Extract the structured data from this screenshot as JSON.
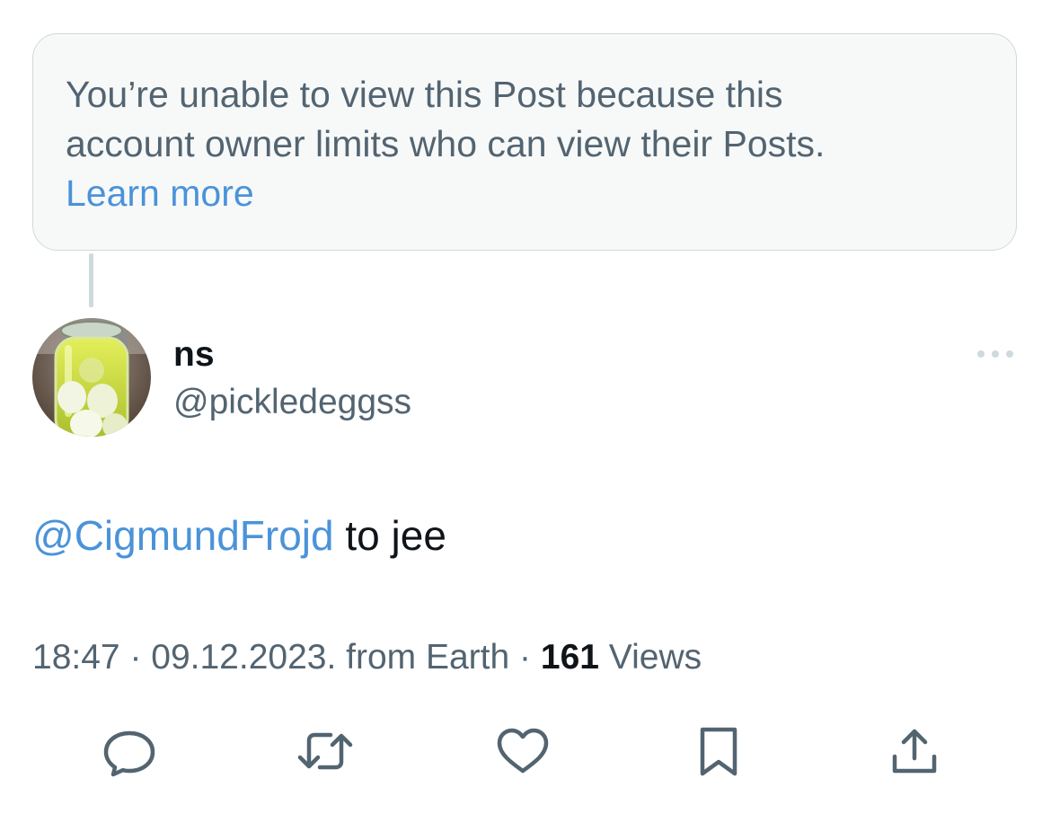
{
  "notice": {
    "line1": "You’re unable to view this Post because this",
    "line2": "account owner limits who can view their Posts.",
    "learn_more": "Learn more"
  },
  "post": {
    "author": {
      "display_name": "ns",
      "handle": "@pickledeggss",
      "avatar_icon": "pickled-eggs-jar-avatar"
    },
    "mention": "@CigmundFrojd",
    "text": " to jee",
    "meta": {
      "time": "18:47",
      "separator1": " · ",
      "date": "09.12.2023.",
      "source": " from Earth",
      "separator2": " · ",
      "views_count": "161",
      "views_label": " Views"
    }
  },
  "actions": {
    "reply_icon": "reply-icon",
    "repost_icon": "repost-icon",
    "like_icon": "like-icon",
    "bookmark_icon": "bookmark-icon",
    "share_icon": "share-icon"
  },
  "colors": {
    "link": "#4a93d9",
    "secondary_text": "#536471",
    "primary_text": "#0f1419",
    "notice_bg": "#f7f9f9",
    "border": "#cfd9de"
  }
}
